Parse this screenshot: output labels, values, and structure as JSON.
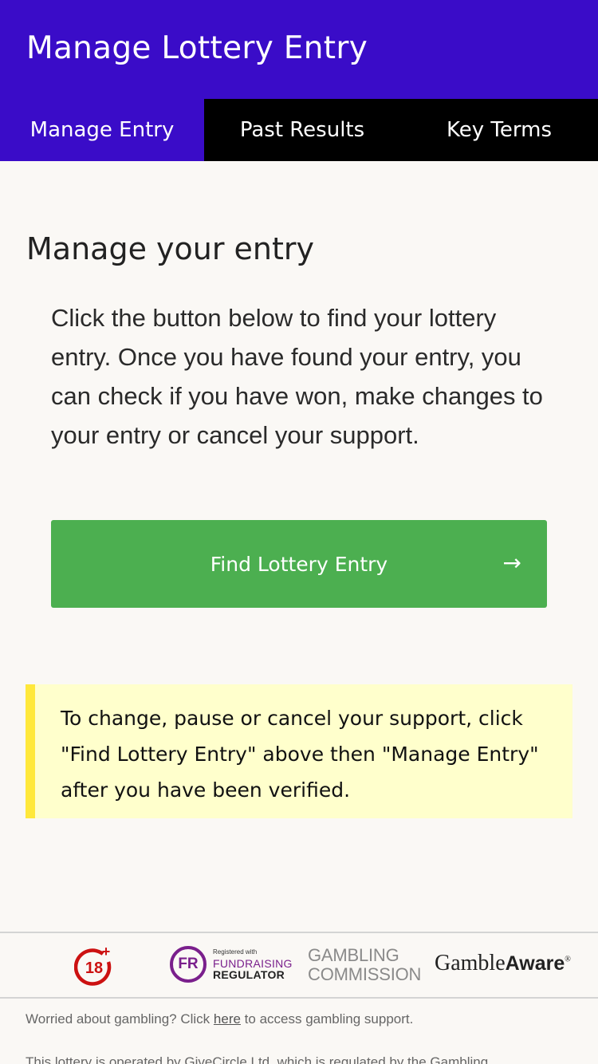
{
  "header": {
    "title": "Manage Lottery Entry"
  },
  "tabs": [
    {
      "label": "Manage Entry",
      "active": true
    },
    {
      "label": "Past Results",
      "active": false
    },
    {
      "label": "Key Terms",
      "active": false
    }
  ],
  "main": {
    "title": "Manage your entry",
    "intro": "Click the button below to find your lottery entry. Once you have found your entry, you can check if you have won, make changes to your entry or cancel your support.",
    "find_button": {
      "label": "Find Lottery Entry",
      "arrow": "→"
    },
    "notice": "To change, pause or cancel your support, click \"Find Lottery Entry\" above then \"Manage Entry\" after you have been verified."
  },
  "footer": {
    "logos": {
      "age": "18",
      "age_plus": "+",
      "fr_mark": "FR",
      "fr_small": "Registered with",
      "fr_mid": "FUNDRAISING",
      "fr_big": "REGULATOR",
      "gc_line1": "GAMBLING",
      "gc_line2": "COMMISSION",
      "ga_part1": "Gamble",
      "ga_part2": "Aware",
      "ga_mark": "®"
    },
    "worried_prefix": "Worried about gambling? Click ",
    "worried_link": "here",
    "worried_suffix": " to access gambling support.",
    "operator_text": "This lottery is operated by GiveCircle Ltd, which is regulated by the Gambling"
  },
  "colors": {
    "header_bg": "#3a0cc8",
    "tab_bg": "#000000",
    "button_bg": "#4caf50",
    "notice_bg": "#ffffcc",
    "notice_border": "#ffe83b",
    "age_red": "#cc1111",
    "fr_purple": "#7a1f8c"
  },
  "icons": {
    "button_arrow": "right-arrow-icon"
  }
}
